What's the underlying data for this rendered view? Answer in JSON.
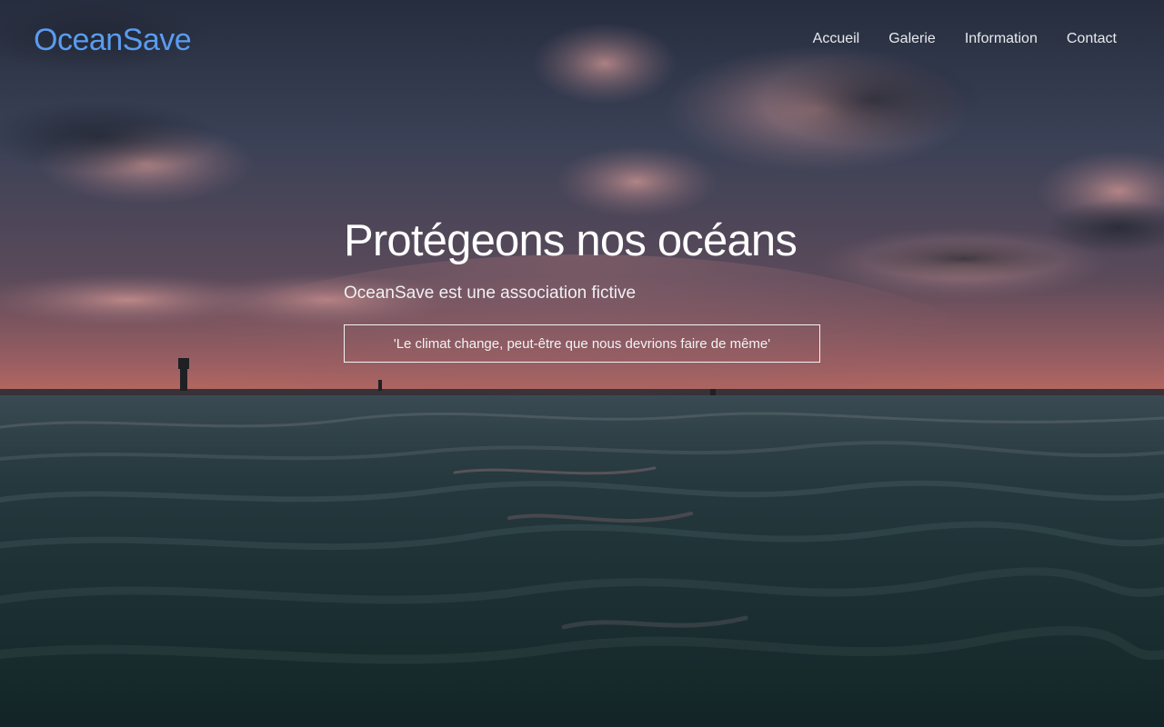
{
  "header": {
    "logo": "OceanSave",
    "nav": [
      {
        "label": "Accueil"
      },
      {
        "label": "Galerie"
      },
      {
        "label": "Information"
      },
      {
        "label": "Contact"
      }
    ]
  },
  "hero": {
    "title": "Protégeons nos océans",
    "subtitle": "OceanSave est une association fictive",
    "quote": "'Le climat change, peut-être que nous devrions faire de même'"
  },
  "colors": {
    "logo": "#5a9cf0",
    "text": "#ffffff",
    "sky_top": "#2c3448",
    "horizon_glow": "#c0706c",
    "sea": "#1c3236"
  }
}
